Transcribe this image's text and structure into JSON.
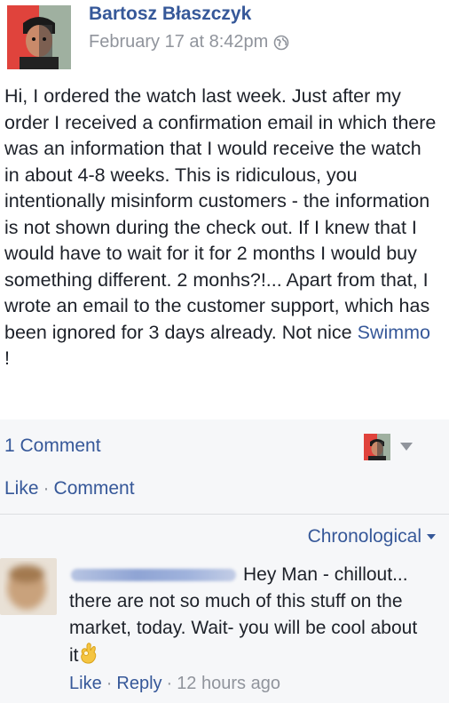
{
  "post": {
    "author": "Bartosz Błaszczyk",
    "timestamp": "February 17 at 8:42pm",
    "privacy_icon": "globe-icon",
    "body": "Hi, I ordered the watch last week. Just after my order I received a confirmation email in which there was an information that I would receive the watch in about 4-8 weeks. This is ridiculous, you intentionally misinform customers - the information is not shown during the check out. If I knew that I would have to wait for it for 2 months I would buy something different. 2 monhs?!... Apart from that, I wrote an email to the customer support, which has been ignored for 3 days already. Not nice ",
    "mention": "Swimmo",
    "body_end": " !"
  },
  "stats": {
    "comment_count": "1 Comment"
  },
  "actions": {
    "like": "Like",
    "separator": "·",
    "comment": "Comment"
  },
  "sort": {
    "label": "Chronological"
  },
  "comment": {
    "text_line1": "Hey Man -",
    "text_rest": "chillout... there are not so much of this stuff on the market, today. Wait- you will be cool about it",
    "emoji": "ok-hand-emoji",
    "like": "Like",
    "reply": "Reply",
    "separator": "·",
    "time": "12 hours ago"
  },
  "colors": {
    "link": "#365899",
    "muted": "#90949c",
    "text": "#1d2129",
    "panel": "#f6f7f9"
  }
}
